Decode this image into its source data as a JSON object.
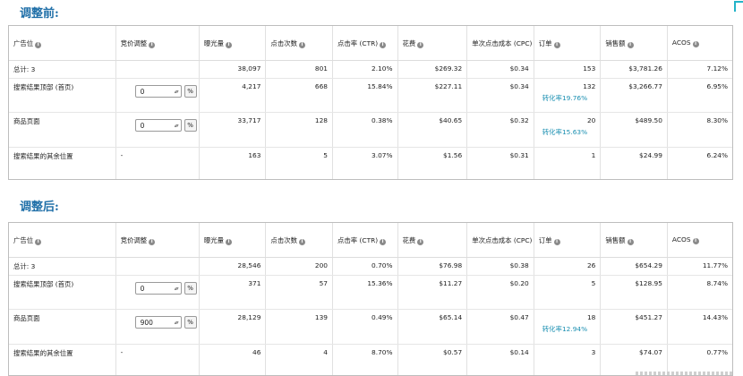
{
  "before": {
    "title": "调整前:",
    "headers": [
      "广告位",
      "竞价调整",
      "曝光量",
      "点击次数",
      "点击率 (CTR)",
      "花费",
      "单次点击成本 (CPC)",
      "订单",
      "销售额",
      "ACOS"
    ],
    "total": {
      "placement": "总计: 3",
      "bid": "",
      "impr": "38,097",
      "clicks": "801",
      "ctr": "2.10%",
      "spend": "$269.32",
      "cpc": "$0.34",
      "orders": "153",
      "sales": "$3,781.26",
      "acos": "7.12%"
    },
    "rows": [
      {
        "placement": "搜索结果顶部 (首页)",
        "bid": "0",
        "unit": "%",
        "impr": "4,217",
        "clicks": "668",
        "ctr": "15.84%",
        "spend": "$227.11",
        "cpc": "$0.34",
        "orders": "132",
        "cvr": "转化率19.76%",
        "sales": "$3,266.77",
        "acos": "6.95%"
      },
      {
        "placement": "商品页面",
        "bid": "0",
        "unit": "%",
        "impr": "33,717",
        "clicks": "128",
        "ctr": "0.38%",
        "spend": "$40.65",
        "cpc": "$0.32",
        "orders": "20",
        "cvr": "转化率15.63%",
        "sales": "$489.50",
        "acos": "8.30%"
      },
      {
        "placement": "搜索结果的其余位置",
        "bid": "-",
        "impr": "163",
        "clicks": "5",
        "ctr": "3.07%",
        "spend": "$1.56",
        "cpc": "$0.31",
        "orders": "1",
        "sales": "$24.99",
        "acos": "6.24%"
      }
    ]
  },
  "after": {
    "title": "调整后:",
    "headers": [
      "广告位",
      "竞价调整",
      "曝光量",
      "点击次数",
      "点击率 (CTR)",
      "花费",
      "单次点击成本 (CPC)",
      "订单",
      "销售额",
      "ACOS"
    ],
    "total": {
      "placement": "总计: 3",
      "bid": "",
      "impr": "28,546",
      "clicks": "200",
      "ctr": "0.70%",
      "spend": "$76.98",
      "cpc": "$0.38",
      "orders": "26",
      "sales": "$654.29",
      "acos": "11.77%"
    },
    "rows": [
      {
        "placement": "搜索结果顶部 (首页)",
        "bid": "0",
        "unit": "%",
        "impr": "371",
        "clicks": "57",
        "ctr": "15.36%",
        "spend": "$11.27",
        "cpc": "$0.20",
        "orders": "5",
        "sales": "$128.95",
        "acos": "8.74%"
      },
      {
        "placement": "商品页面",
        "bid": "900",
        "unit": "%",
        "impr": "28,129",
        "clicks": "139",
        "ctr": "0.49%",
        "spend": "$65.14",
        "cpc": "$0.47",
        "orders": "18",
        "cvr": "转化率12.94%",
        "sales": "$451.27",
        "acos": "14.43%"
      },
      {
        "placement": "搜索结果的其余位置",
        "bid": "-",
        "impr": "46",
        "clicks": "4",
        "ctr": "8.70%",
        "spend": "$0.57",
        "cpc": "$0.14",
        "orders": "3",
        "sales": "$74.07",
        "acos": "0.77%"
      }
    ]
  },
  "icons": {
    "info": "info-circle-icon",
    "spinner": "spinner-arrows-icon"
  },
  "colors": {
    "title": "#1f6fa8",
    "conversion_text": "#1a8fb1",
    "border": "#bdbdbd"
  }
}
